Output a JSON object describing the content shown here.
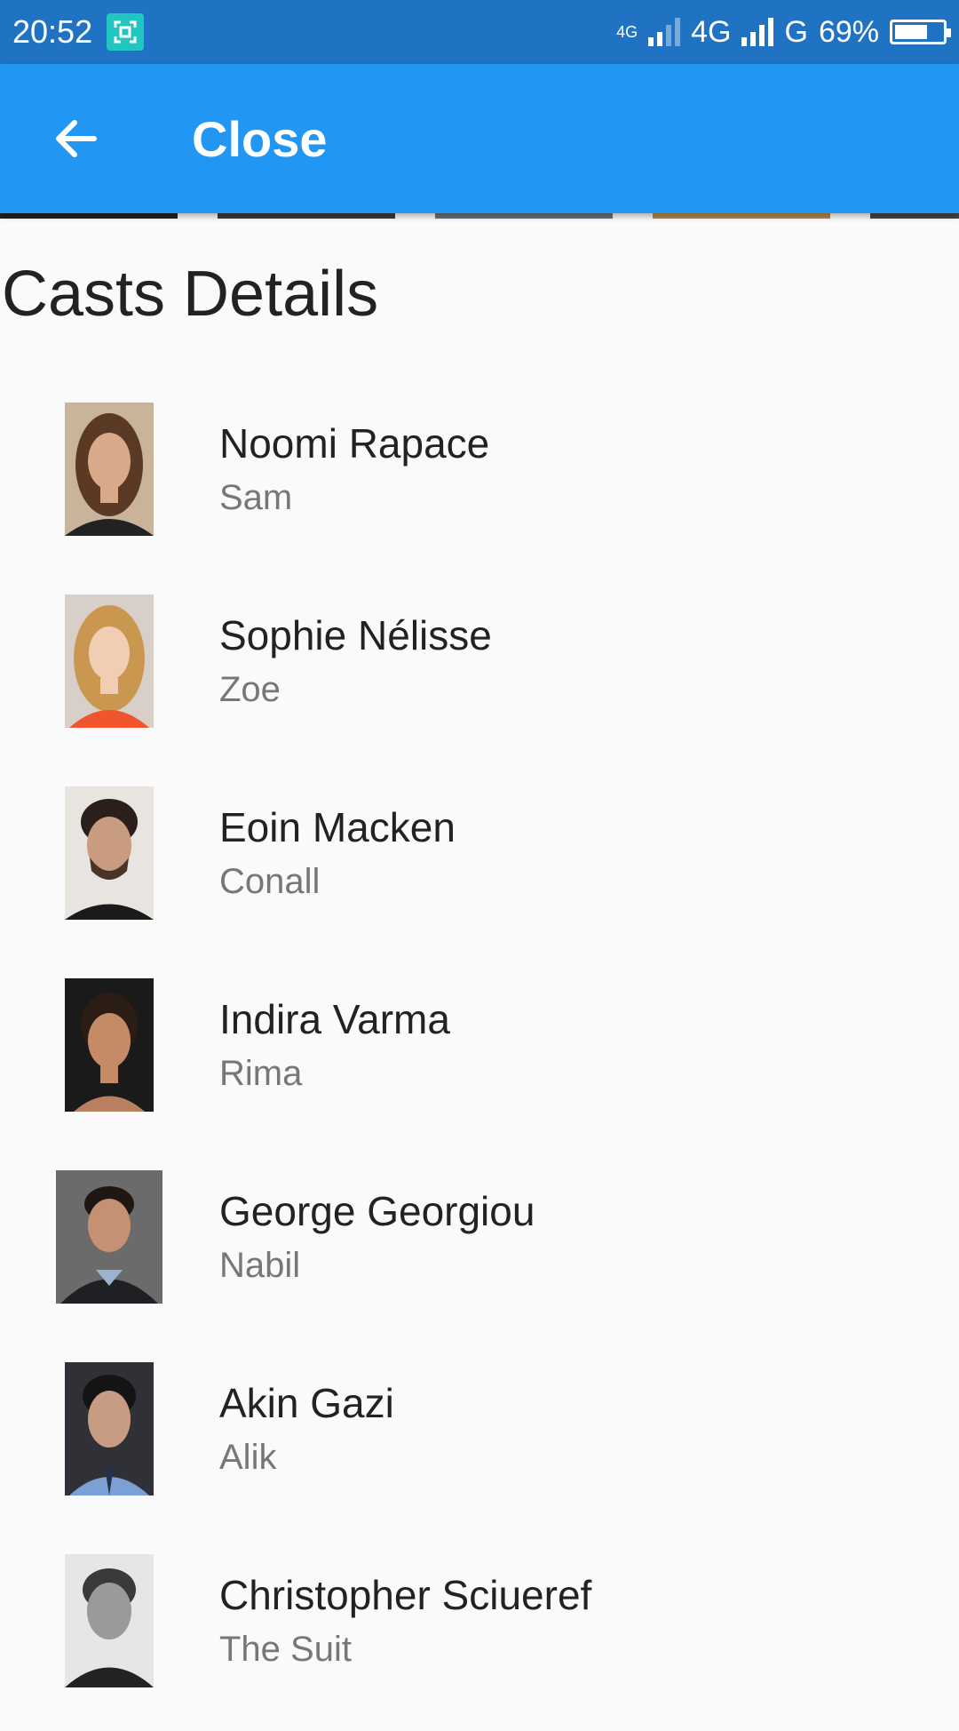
{
  "status_bar": {
    "time": "20:52",
    "network1": "4G",
    "network2": "G",
    "battery_text": "69%",
    "battery_level": 0.69
  },
  "app_bar": {
    "back_icon": "arrow-back-icon",
    "title": "Close",
    "color": "#2196f3"
  },
  "section_title": "Casts Details",
  "casts": [
    {
      "name": "Noomi Rapace",
      "character": "Sam"
    },
    {
      "name": "Sophie Nélisse",
      "character": "Zoe"
    },
    {
      "name": "Eoin Macken",
      "character": "Conall"
    },
    {
      "name": "Indira Varma",
      "character": "Rima"
    },
    {
      "name": "George Georgiou",
      "character": "Nabil"
    },
    {
      "name": "Akin Gazi",
      "character": "Alik"
    },
    {
      "name": "Christopher Sciueref",
      "character": "The Suit"
    }
  ]
}
